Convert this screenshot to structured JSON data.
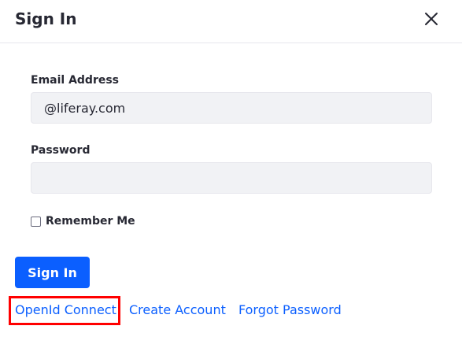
{
  "modal": {
    "title": "Sign In",
    "close_icon": "close-icon"
  },
  "form": {
    "email": {
      "label": "Email Address",
      "value": "@liferay.com",
      "placeholder": ""
    },
    "password": {
      "label": "Password",
      "value": "",
      "placeholder": ""
    },
    "remember_me": {
      "label": "Remember Me",
      "checked": false
    },
    "submit_label": "Sign In"
  },
  "links": {
    "openid": "OpenId Connect",
    "create_account": "Create Account",
    "forgot_password": "Forgot Password"
  },
  "colors": {
    "accent": "#0b5fff",
    "highlight": "#ff0000",
    "input_bg": "#f1f2f5"
  }
}
